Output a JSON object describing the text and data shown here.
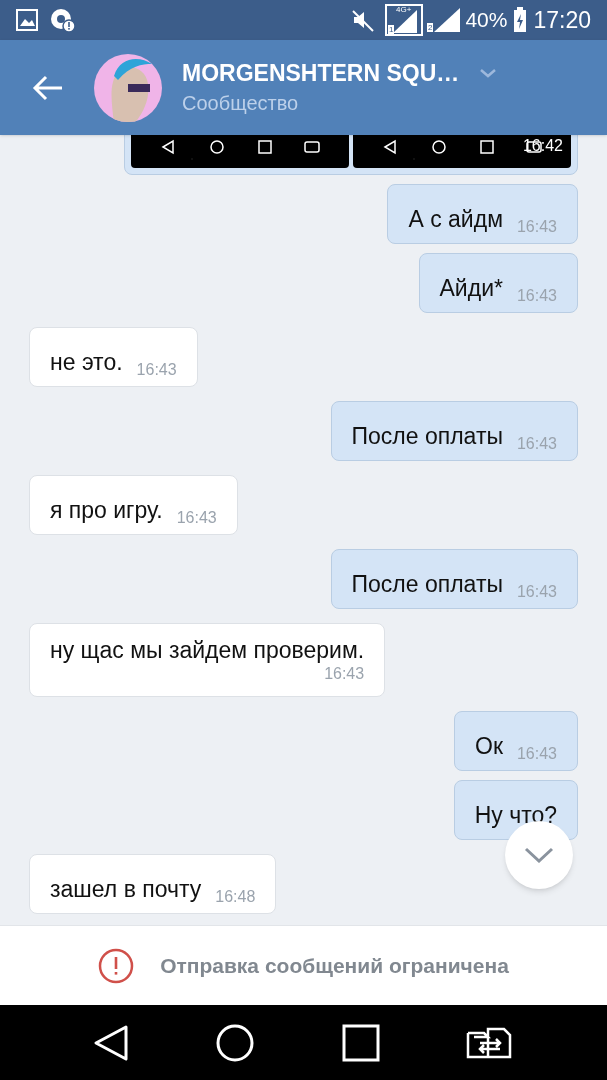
{
  "status_bar": {
    "network_type": "4G+",
    "sim_1": "1",
    "sim_2": "2",
    "battery": "40%",
    "time": "17:20"
  },
  "header": {
    "title": "MORGENSHTERN SQU…",
    "subtitle": "Сообщество"
  },
  "messages": [
    {
      "kind": "images",
      "outgoing": true,
      "time": "16:42"
    },
    {
      "kind": "text",
      "outgoing": true,
      "text": "А с айдм",
      "time": "16:43"
    },
    {
      "kind": "text",
      "outgoing": true,
      "text": "Айди*",
      "time": "16:43"
    },
    {
      "kind": "text",
      "outgoing": false,
      "text": "не это.",
      "time": "16:43"
    },
    {
      "kind": "text",
      "outgoing": true,
      "text": "После оплаты",
      "time": "16:43"
    },
    {
      "kind": "text",
      "outgoing": false,
      "text": "я про игру.",
      "time": "16:43"
    },
    {
      "kind": "text",
      "outgoing": true,
      "text": "После оплаты",
      "time": "16:43"
    },
    {
      "kind": "text",
      "outgoing": false,
      "text": "ну щас мы зайдем проверим.",
      "time": "16:43",
      "wrapped_time": true
    },
    {
      "kind": "text",
      "outgoing": true,
      "text": "Ок",
      "time": "16:43"
    },
    {
      "kind": "text",
      "outgoing": true,
      "text": "Ну что?"
    },
    {
      "kind": "text",
      "outgoing": false,
      "text": "зашел в почту",
      "time": "16:48"
    }
  ],
  "composer": {
    "notice": "Отправка сообщений ограничена"
  }
}
